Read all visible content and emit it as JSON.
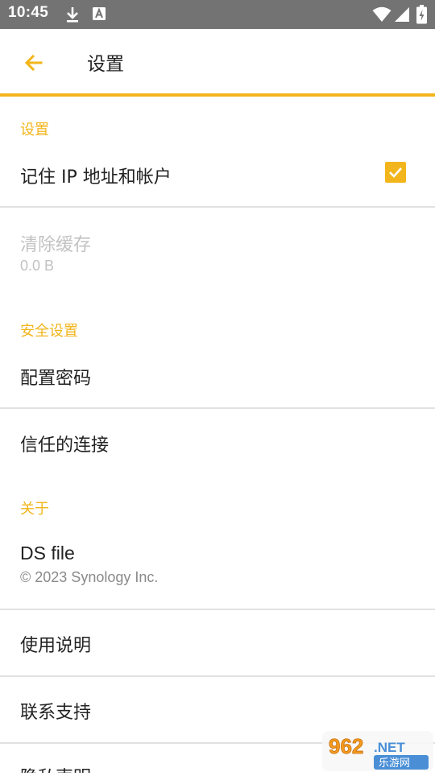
{
  "status_bar": {
    "time": "10:45",
    "icons": [
      "download-icon",
      "font-icon",
      "wifi-icon",
      "signal-icon",
      "battery-icon"
    ]
  },
  "app_bar": {
    "title": "设置",
    "back_icon": "arrow-left-icon",
    "accent_color": "#f2b51c"
  },
  "sections": {
    "settings": {
      "header": "设置",
      "remember": {
        "title": "记住 IP 地址和帐户",
        "checked": true
      },
      "clear_cache": {
        "title": "清除缓存",
        "value": "0.0 B",
        "disabled": true
      }
    },
    "security": {
      "header": "安全设置",
      "config_password": "配置密码",
      "trusted_connections": "信任的连接"
    },
    "about": {
      "header": "关于",
      "app_name": "DS file",
      "copyright": "© 2023 Synology Inc.",
      "usage": "使用说明",
      "contact": "联系支持",
      "privacy": "隐私声明"
    }
  },
  "watermark": {
    "top": "962.NET",
    "bottom": "乐游网"
  }
}
